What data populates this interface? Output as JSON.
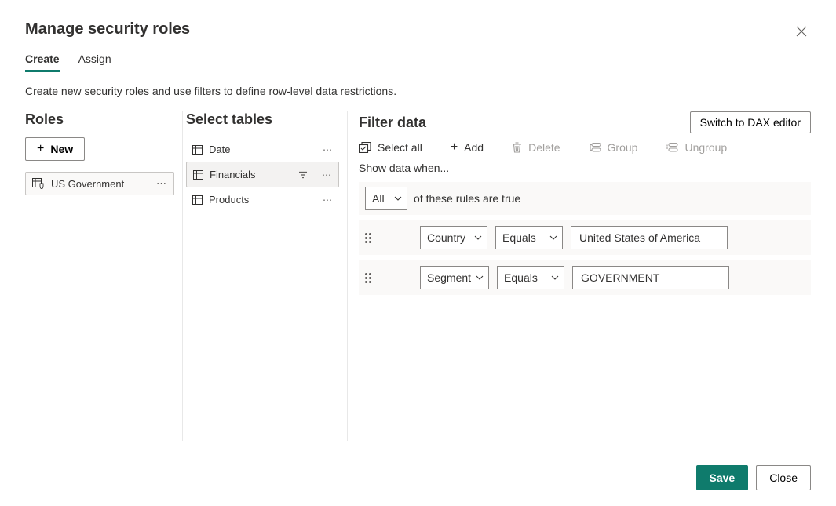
{
  "header": {
    "title": "Manage security roles"
  },
  "tabs": {
    "create": "Create",
    "assign": "Assign"
  },
  "description": "Create new security roles and use filters to define row-level data restrictions.",
  "roles": {
    "heading": "Roles",
    "new_label": "New",
    "items": [
      "US Government"
    ]
  },
  "tables": {
    "heading": "Select tables",
    "items": [
      "Date",
      "Financials",
      "Products"
    ],
    "selected_index": 1
  },
  "filter": {
    "heading": "Filter data",
    "dax_label": "Switch to DAX editor",
    "toolbar": {
      "select_all": "Select all",
      "add": "Add",
      "delete": "Delete",
      "group": "Group",
      "ungroup": "Ungroup"
    },
    "subheading": "Show data when...",
    "combinator": "All",
    "combinator_suffix": "of these rules are true",
    "rules": [
      {
        "field": "Country",
        "operator": "Equals",
        "value": "United States of America"
      },
      {
        "field": "Segment",
        "operator": "Equals",
        "value": "GOVERNMENT"
      }
    ]
  },
  "footer": {
    "save": "Save",
    "close": "Close"
  }
}
